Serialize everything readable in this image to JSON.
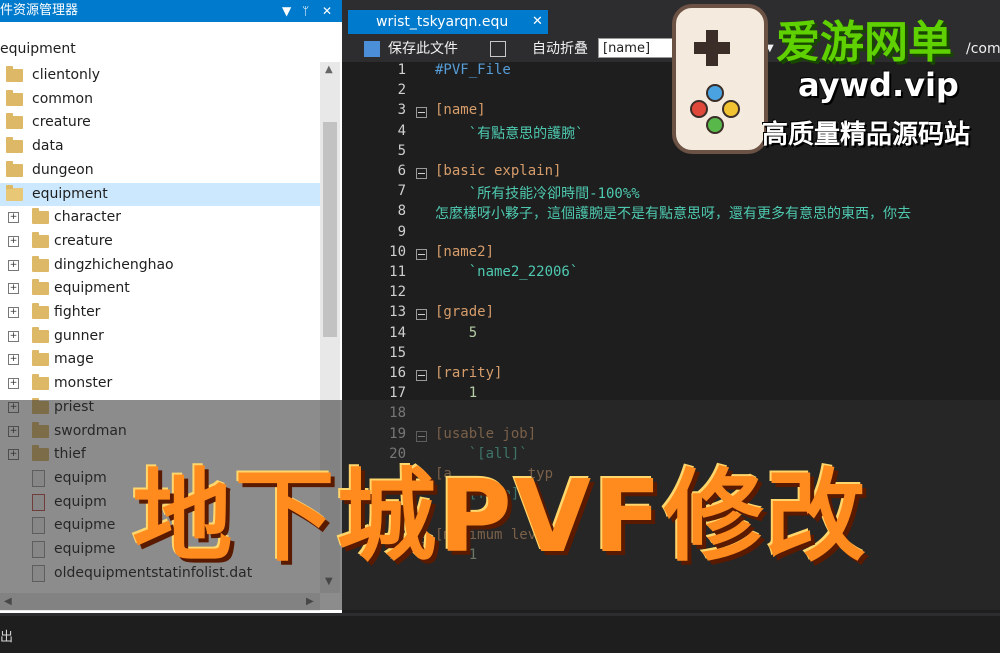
{
  "explorer": {
    "title": "件资源管理器",
    "dropdown_icon": "▼",
    "pin_icon": "ᛘ",
    "close_icon": "✕",
    "path": "equipment",
    "items": [
      {
        "label": "clientonly",
        "kind": "folder",
        "level": 0
      },
      {
        "label": "common",
        "kind": "folder",
        "level": 0
      },
      {
        "label": "creature",
        "kind": "folder",
        "level": 0
      },
      {
        "label": "data",
        "kind": "folder",
        "level": 0
      },
      {
        "label": "dungeon",
        "kind": "folder",
        "level": 0
      },
      {
        "label": "equipment",
        "kind": "folder-open",
        "level": 0,
        "selected": true
      },
      {
        "label": "character",
        "kind": "folder",
        "level": 1
      },
      {
        "label": "creature",
        "kind": "folder",
        "level": 1
      },
      {
        "label": "dingzhichenghao",
        "kind": "folder",
        "level": 1
      },
      {
        "label": "equipment",
        "kind": "folder",
        "level": 1
      },
      {
        "label": "fighter",
        "kind": "folder",
        "level": 1
      },
      {
        "label": "gunner",
        "kind": "folder",
        "level": 1
      },
      {
        "label": "mage",
        "kind": "folder",
        "level": 1
      },
      {
        "label": "monster",
        "kind": "folder",
        "level": 1
      },
      {
        "label": "priest",
        "kind": "folder",
        "level": 1
      },
      {
        "label": "swordman",
        "kind": "folder",
        "level": 1
      },
      {
        "label": "thief",
        "kind": "folder",
        "level": 1
      },
      {
        "label": "equipm",
        "kind": "file",
        "level": 1
      },
      {
        "label": "equipm",
        "kind": "file-red",
        "level": 1
      },
      {
        "label": "equipme",
        "kind": "file",
        "level": 1
      },
      {
        "label": "equipme",
        "kind": "file",
        "level": 1
      },
      {
        "label": "oldequipmentstatinfolist.dat",
        "kind": "file",
        "level": 1
      }
    ]
  },
  "editor": {
    "tab_label": "wrist_tskyarqn.equ",
    "tab_close": "✕",
    "toolbar": {
      "save_label": "保存此文件",
      "auto_fold_label": "自动折叠",
      "nav_value": "[name]",
      "right_fragment": "/com"
    },
    "lines": [
      {
        "n": "1",
        "text": "#PVF_File",
        "cls": "c-dir",
        "fold": false
      },
      {
        "n": "2",
        "text": "",
        "cls": "c-txt",
        "fold": false
      },
      {
        "n": "3",
        "text": "[name]",
        "cls": "c-sec",
        "fold": true
      },
      {
        "n": "4",
        "text": "    `有點意思的護腕`",
        "cls": "c-str",
        "fold": false
      },
      {
        "n": "5",
        "text": "",
        "cls": "c-txt",
        "fold": false
      },
      {
        "n": "6",
        "text": "[basic explain]",
        "cls": "c-sec",
        "fold": true
      },
      {
        "n": "7",
        "text": "    `所有技能冷卻時間-100%%",
        "cls": "c-str",
        "fold": false
      },
      {
        "n": "8",
        "text": "怎麼樣呀小夥子，這個護腕是不是有點意思呀，還有更多有意思的東西，你去",
        "cls": "c-txt",
        "fold": false
      },
      {
        "n": "9",
        "text": "",
        "cls": "c-txt",
        "fold": false
      },
      {
        "n": "10",
        "text": "[name2]",
        "cls": "c-sec",
        "fold": true
      },
      {
        "n": "11",
        "text": "    `name2_22006`",
        "cls": "c-str",
        "fold": false
      },
      {
        "n": "12",
        "text": "",
        "cls": "c-txt",
        "fold": false
      },
      {
        "n": "13",
        "text": "[grade]",
        "cls": "c-sec",
        "fold": true
      },
      {
        "n": "14",
        "text": "    5",
        "cls": "c-num",
        "fold": false
      },
      {
        "n": "15",
        "text": "",
        "cls": "c-txt",
        "fold": false
      },
      {
        "n": "16",
        "text": "[rarity]",
        "cls": "c-sec",
        "fold": true
      },
      {
        "n": "17",
        "text": "    1",
        "cls": "c-num",
        "fold": false
      },
      {
        "n": "18",
        "text": "",
        "cls": "c-txt",
        "fold": false
      },
      {
        "n": "19",
        "text": "[usable job]",
        "cls": "c-sec",
        "fold": true
      },
      {
        "n": "20",
        "text": "    `[all]`",
        "cls": "c-str",
        "fold": false
      },
      {
        "n": "",
        "text": "[a         typ",
        "cls": "c-sec",
        "fold": false
      },
      {
        "n": "",
        "text": "    [free]`",
        "cls": "c-str",
        "fold": false
      },
      {
        "n": "",
        "text": "",
        "cls": "c-txt",
        "fold": false
      },
      {
        "n": "26",
        "text": "[minimum level]",
        "cls": "c-sec",
        "fold": true
      },
      {
        "n": "27",
        "text": "    1",
        "cls": "c-num",
        "fold": false
      }
    ]
  },
  "output": {
    "label": "出"
  },
  "overlay": {
    "banner_text": "地下城PVF修改",
    "logo_title": "爱游网单",
    "logo_url": "aywd.vip",
    "logo_tagline": "高质量精品源码站"
  },
  "colors": {
    "accent": "#007acc",
    "editor_bg": "#1e1e1e",
    "section": "#d69d6b",
    "string": "#4ec9b0",
    "banner": "#ff8a1e",
    "logo_green": "#5fd000"
  }
}
